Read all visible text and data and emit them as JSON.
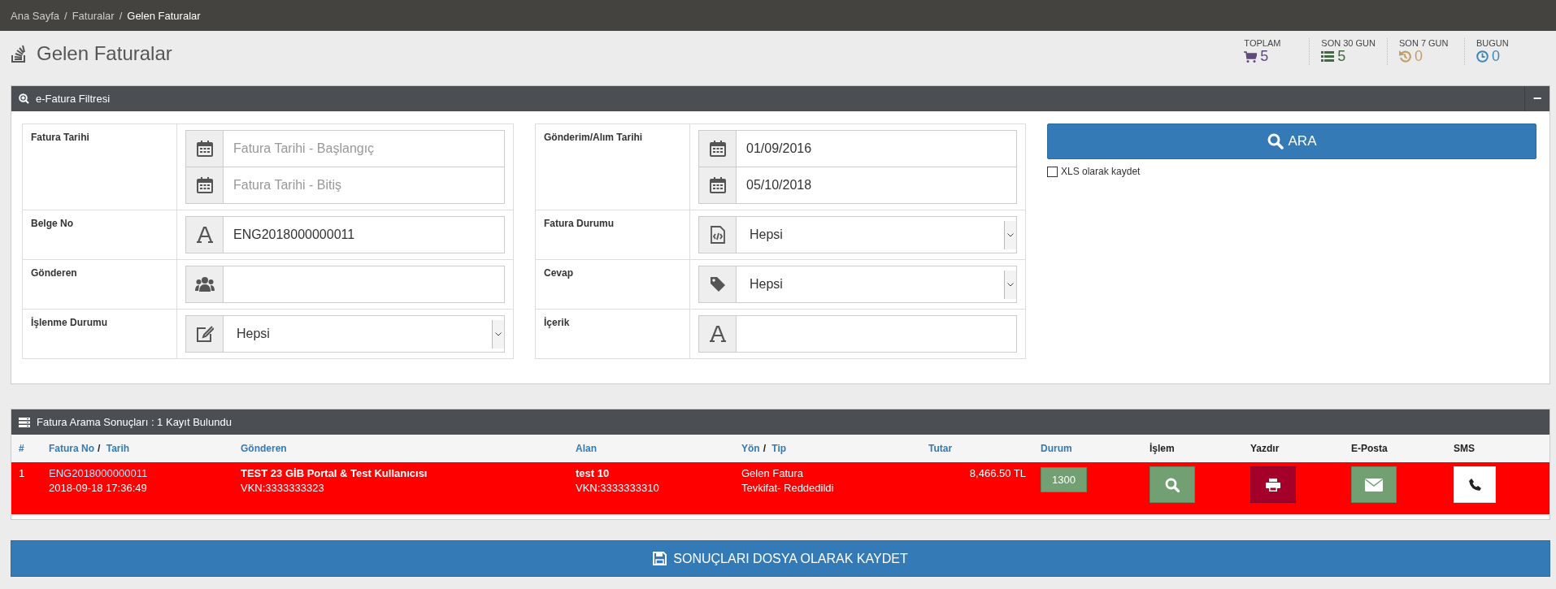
{
  "breadcrumb": [
    {
      "label": "Ana Sayfa",
      "current": false
    },
    {
      "label": "Faturalar",
      "current": false
    },
    {
      "label": "Gelen Faturalar",
      "current": true
    }
  ],
  "breadcrumb_separator": "/",
  "page_title": "Gelen Faturalar",
  "stats": [
    {
      "label": "TOPLAM",
      "value": "5",
      "kind": "cart",
      "color": "#5f4b7b"
    },
    {
      "label": "SON 30 GUN",
      "value": "5",
      "kind": "list",
      "color": "#3f6b3f"
    },
    {
      "label": "SON 7 GUN",
      "value": "0",
      "kind": "history",
      "color": "#bfa06a"
    },
    {
      "label": "BUGUN",
      "value": "0",
      "kind": "clock",
      "color": "#3f87b3"
    }
  ],
  "filter_panel": {
    "title": "e-Fatura Filtresi",
    "collapse_symbol": "−",
    "columns": [
      [
        {
          "label": "Fatura Tarihi",
          "kind": "date_range",
          "fields": [
            {
              "kind": "calendar",
              "placeholder": "Fatura Tarihi - Başlangıç"
            },
            {
              "kind": "calendar",
              "placeholder": "Fatura Tarihi - Bitiş"
            }
          ]
        },
        {
          "label": "Belge No",
          "kind": "text",
          "fields": [
            {
              "kind": "letter",
              "value": "ENG2018000000011"
            }
          ]
        },
        {
          "label": "Gönderen",
          "kind": "text",
          "fields": [
            {
              "kind": "users"
            }
          ]
        },
        {
          "label": "İşlenme Durumu",
          "kind": "select",
          "fields": [
            {
              "kind": "edit",
              "value": "Hepsi"
            }
          ]
        }
      ],
      [
        {
          "label": "Gönderim/Alım Tarihi",
          "kind": "date_range",
          "fields": [
            {
              "kind": "calendar",
              "value": "01/09/2016"
            },
            {
              "kind": "calendar",
              "value": "05/10/2018"
            }
          ]
        },
        {
          "label": "Fatura Durumu",
          "kind": "select",
          "fields": [
            {
              "kind": "file_code",
              "value": "Hepsi"
            }
          ]
        },
        {
          "label": "Cevap",
          "kind": "select",
          "fields": [
            {
              "kind": "tag",
              "value": "Hepsi"
            }
          ]
        },
        {
          "label": "İçerik",
          "kind": "text",
          "fields": [
            {
              "kind": "letter"
            }
          ]
        }
      ]
    ],
    "search_button": "ARA",
    "xls_option": {
      "label": "XLS olarak kaydet",
      "checked": false
    }
  },
  "results_panel": {
    "title": "Fatura Arama Sonuçları : 1 Kayıt Bulundu",
    "columns": [
      {
        "labels": [
          "#"
        ],
        "sortable": true
      },
      {
        "labels": [
          "Fatura No",
          "Tarih"
        ],
        "separator": "/",
        "sortable": true
      },
      {
        "labels": [
          "Gönderen"
        ],
        "sortable": true
      },
      {
        "labels": [
          "Alan"
        ],
        "sortable": true
      },
      {
        "labels": [
          "Yön",
          "Tip"
        ],
        "separator": "/",
        "sortable": true
      },
      {
        "labels": [
          "Tutar"
        ],
        "sortable": true
      },
      {
        "labels": [
          "Durum"
        ],
        "sortable": true
      },
      {
        "labels": [
          "İşlem"
        ],
        "sortable": false
      },
      {
        "labels": [
          "Yazdır"
        ],
        "sortable": false
      },
      {
        "labels": [
          "E-Posta"
        ],
        "sortable": false
      },
      {
        "labels": [
          "SMS"
        ],
        "sortable": false
      }
    ],
    "rows": [
      {
        "color": "#ff0000",
        "number": "1",
        "invoice_no": "ENG2018000000011",
        "date": "2018-09-18 17:36:49",
        "sender_name": "TEST 23 GİB Portal & Test Kullanıcısı",
        "sender_vkn": "VKN:3333333323",
        "receiver_name": "test 10",
        "receiver_vkn": "VKN:3333333310",
        "direction": "Gelen Fatura",
        "type": "Tevkifat- Reddedildi",
        "amount": "8,466.50 TL",
        "status": "1300",
        "actions": [
          {
            "kind": "view"
          },
          {
            "kind": "print"
          },
          {
            "kind": "email"
          },
          {
            "kind": "sms"
          }
        ]
      }
    ]
  },
  "save_button": "SONUÇLARI DOSYA OLARAK KAYDET"
}
